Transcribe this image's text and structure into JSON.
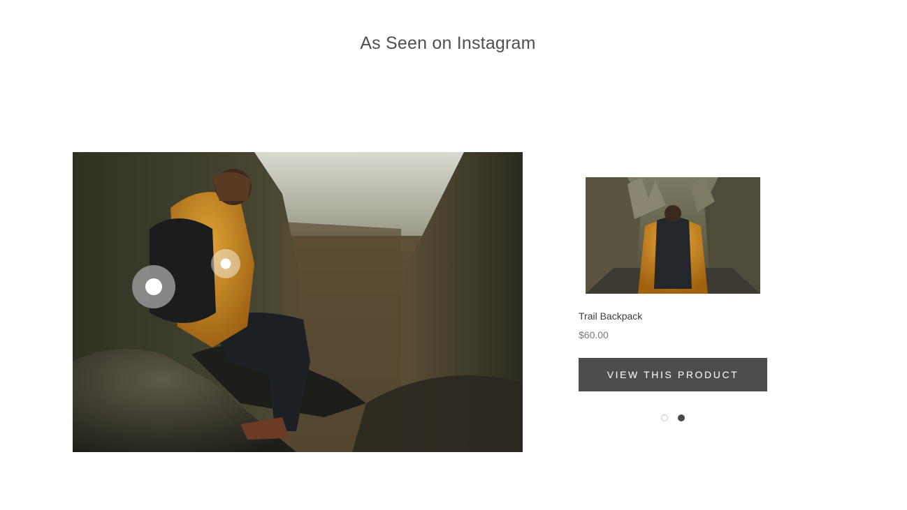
{
  "section": {
    "title": "As Seen on Instagram"
  },
  "feature": {
    "image_alt": "hiker-with-backpack-on-rock",
    "hotspots": [
      {
        "name": "hotspot-primary",
        "state": "active"
      },
      {
        "name": "hotspot-secondary",
        "state": "inactive"
      }
    ]
  },
  "product": {
    "name": "Trail Backpack",
    "price": "$60.00",
    "button_label": "VIEW THIS PRODUCT",
    "image_alt": "hiker-in-canyon-backpack"
  },
  "pager": {
    "total": 2,
    "active_index": 2
  },
  "colors": {
    "button_bg": "#4d4d4d",
    "text": "#4a4a4a",
    "jacket_accent": "#c98a1e"
  }
}
